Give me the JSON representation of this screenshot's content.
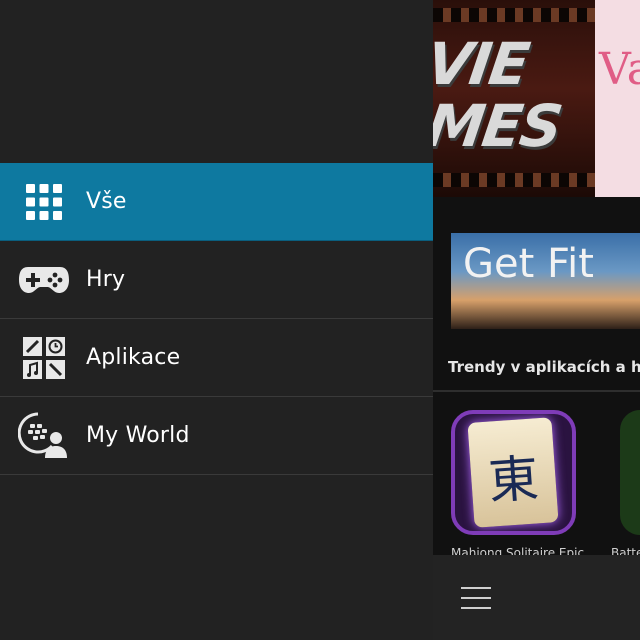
{
  "sidebar": {
    "items": [
      {
        "label": "Vše",
        "icon": "grid-icon",
        "selected": true
      },
      {
        "label": "Hry",
        "icon": "gamepad-icon",
        "selected": false
      },
      {
        "label": "Aplikace",
        "icon": "apps-icon",
        "selected": false
      },
      {
        "label": "My World",
        "icon": "my-world-icon",
        "selected": false
      }
    ]
  },
  "content": {
    "banner1_text_line1": "VIE",
    "banner1_text_line2": "MES",
    "banner1_partial_text": "Va",
    "banner2_text": "Get Fit",
    "section_title": "Trendy v aplikacích a hrác",
    "apps": [
      {
        "name": "Mahjong Solitaire Epic",
        "icon": "mahjong-icon"
      },
      {
        "name": "Batte",
        "icon": "battery-icon"
      }
    ],
    "mahjong_glyph": "東"
  },
  "colors": {
    "selected": "#0e79a0",
    "sidebar_bg": "#222222",
    "divider": "#3a3a3a"
  }
}
